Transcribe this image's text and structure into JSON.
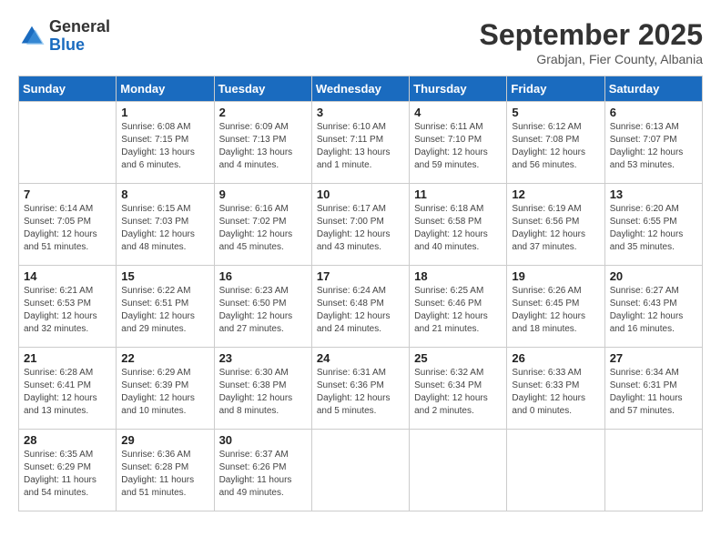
{
  "logo": {
    "general": "General",
    "blue": "Blue"
  },
  "header": {
    "month": "September 2025",
    "location": "Grabjan, Fier County, Albania"
  },
  "days_of_week": [
    "Sunday",
    "Monday",
    "Tuesday",
    "Wednesday",
    "Thursday",
    "Friday",
    "Saturday"
  ],
  "weeks": [
    [
      {
        "day": "",
        "sunrise": "",
        "sunset": "",
        "daylight": ""
      },
      {
        "day": "1",
        "sunrise": "Sunrise: 6:08 AM",
        "sunset": "Sunset: 7:15 PM",
        "daylight": "Daylight: 13 hours and 6 minutes."
      },
      {
        "day": "2",
        "sunrise": "Sunrise: 6:09 AM",
        "sunset": "Sunset: 7:13 PM",
        "daylight": "Daylight: 13 hours and 4 minutes."
      },
      {
        "day": "3",
        "sunrise": "Sunrise: 6:10 AM",
        "sunset": "Sunset: 7:11 PM",
        "daylight": "Daylight: 13 hours and 1 minute."
      },
      {
        "day": "4",
        "sunrise": "Sunrise: 6:11 AM",
        "sunset": "Sunset: 7:10 PM",
        "daylight": "Daylight: 12 hours and 59 minutes."
      },
      {
        "day": "5",
        "sunrise": "Sunrise: 6:12 AM",
        "sunset": "Sunset: 7:08 PM",
        "daylight": "Daylight: 12 hours and 56 minutes."
      },
      {
        "day": "6",
        "sunrise": "Sunrise: 6:13 AM",
        "sunset": "Sunset: 7:07 PM",
        "daylight": "Daylight: 12 hours and 53 minutes."
      }
    ],
    [
      {
        "day": "7",
        "sunrise": "Sunrise: 6:14 AM",
        "sunset": "Sunset: 7:05 PM",
        "daylight": "Daylight: 12 hours and 51 minutes."
      },
      {
        "day": "8",
        "sunrise": "Sunrise: 6:15 AM",
        "sunset": "Sunset: 7:03 PM",
        "daylight": "Daylight: 12 hours and 48 minutes."
      },
      {
        "day": "9",
        "sunrise": "Sunrise: 6:16 AM",
        "sunset": "Sunset: 7:02 PM",
        "daylight": "Daylight: 12 hours and 45 minutes."
      },
      {
        "day": "10",
        "sunrise": "Sunrise: 6:17 AM",
        "sunset": "Sunset: 7:00 PM",
        "daylight": "Daylight: 12 hours and 43 minutes."
      },
      {
        "day": "11",
        "sunrise": "Sunrise: 6:18 AM",
        "sunset": "Sunset: 6:58 PM",
        "daylight": "Daylight: 12 hours and 40 minutes."
      },
      {
        "day": "12",
        "sunrise": "Sunrise: 6:19 AM",
        "sunset": "Sunset: 6:56 PM",
        "daylight": "Daylight: 12 hours and 37 minutes."
      },
      {
        "day": "13",
        "sunrise": "Sunrise: 6:20 AM",
        "sunset": "Sunset: 6:55 PM",
        "daylight": "Daylight: 12 hours and 35 minutes."
      }
    ],
    [
      {
        "day": "14",
        "sunrise": "Sunrise: 6:21 AM",
        "sunset": "Sunset: 6:53 PM",
        "daylight": "Daylight: 12 hours and 32 minutes."
      },
      {
        "day": "15",
        "sunrise": "Sunrise: 6:22 AM",
        "sunset": "Sunset: 6:51 PM",
        "daylight": "Daylight: 12 hours and 29 minutes."
      },
      {
        "day": "16",
        "sunrise": "Sunrise: 6:23 AM",
        "sunset": "Sunset: 6:50 PM",
        "daylight": "Daylight: 12 hours and 27 minutes."
      },
      {
        "day": "17",
        "sunrise": "Sunrise: 6:24 AM",
        "sunset": "Sunset: 6:48 PM",
        "daylight": "Daylight: 12 hours and 24 minutes."
      },
      {
        "day": "18",
        "sunrise": "Sunrise: 6:25 AM",
        "sunset": "Sunset: 6:46 PM",
        "daylight": "Daylight: 12 hours and 21 minutes."
      },
      {
        "day": "19",
        "sunrise": "Sunrise: 6:26 AM",
        "sunset": "Sunset: 6:45 PM",
        "daylight": "Daylight: 12 hours and 18 minutes."
      },
      {
        "day": "20",
        "sunrise": "Sunrise: 6:27 AM",
        "sunset": "Sunset: 6:43 PM",
        "daylight": "Daylight: 12 hours and 16 minutes."
      }
    ],
    [
      {
        "day": "21",
        "sunrise": "Sunrise: 6:28 AM",
        "sunset": "Sunset: 6:41 PM",
        "daylight": "Daylight: 12 hours and 13 minutes."
      },
      {
        "day": "22",
        "sunrise": "Sunrise: 6:29 AM",
        "sunset": "Sunset: 6:39 PM",
        "daylight": "Daylight: 12 hours and 10 minutes."
      },
      {
        "day": "23",
        "sunrise": "Sunrise: 6:30 AM",
        "sunset": "Sunset: 6:38 PM",
        "daylight": "Daylight: 12 hours and 8 minutes."
      },
      {
        "day": "24",
        "sunrise": "Sunrise: 6:31 AM",
        "sunset": "Sunset: 6:36 PM",
        "daylight": "Daylight: 12 hours and 5 minutes."
      },
      {
        "day": "25",
        "sunrise": "Sunrise: 6:32 AM",
        "sunset": "Sunset: 6:34 PM",
        "daylight": "Daylight: 12 hours and 2 minutes."
      },
      {
        "day": "26",
        "sunrise": "Sunrise: 6:33 AM",
        "sunset": "Sunset: 6:33 PM",
        "daylight": "Daylight: 12 hours and 0 minutes."
      },
      {
        "day": "27",
        "sunrise": "Sunrise: 6:34 AM",
        "sunset": "Sunset: 6:31 PM",
        "daylight": "Daylight: 11 hours and 57 minutes."
      }
    ],
    [
      {
        "day": "28",
        "sunrise": "Sunrise: 6:35 AM",
        "sunset": "Sunset: 6:29 PM",
        "daylight": "Daylight: 11 hours and 54 minutes."
      },
      {
        "day": "29",
        "sunrise": "Sunrise: 6:36 AM",
        "sunset": "Sunset: 6:28 PM",
        "daylight": "Daylight: 11 hours and 51 minutes."
      },
      {
        "day": "30",
        "sunrise": "Sunrise: 6:37 AM",
        "sunset": "Sunset: 6:26 PM",
        "daylight": "Daylight: 11 hours and 49 minutes."
      },
      {
        "day": "",
        "sunrise": "",
        "sunset": "",
        "daylight": ""
      },
      {
        "day": "",
        "sunrise": "",
        "sunset": "",
        "daylight": ""
      },
      {
        "day": "",
        "sunrise": "",
        "sunset": "",
        "daylight": ""
      },
      {
        "day": "",
        "sunrise": "",
        "sunset": "",
        "daylight": ""
      }
    ]
  ]
}
